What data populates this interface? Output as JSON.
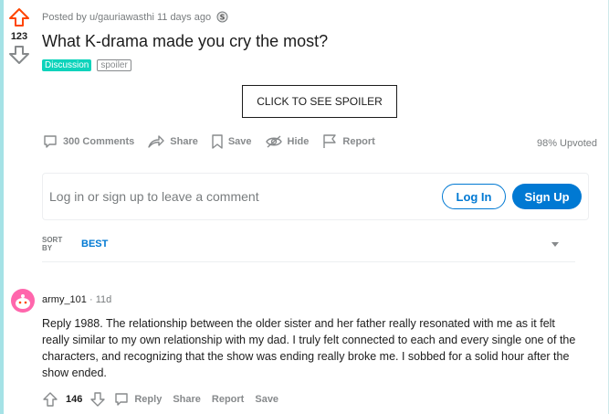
{
  "post": {
    "score": "123",
    "meta": "Posted by u/gauriawasthi 11 days ago",
    "title": "What K-drama made you cry the most?",
    "flairs": [
      "Discussion",
      "spoiler"
    ],
    "spoiler_button": "CLICK TO SEE SPOILER",
    "actions": {
      "comments": "300 Comments",
      "share": "Share",
      "save": "Save",
      "hide": "Hide",
      "report": "Report"
    },
    "upvoted": "98% Upvoted"
  },
  "comment_box": {
    "prompt": "Log in or sign up to leave a comment",
    "login": "Log In",
    "signup": "Sign Up"
  },
  "sort": {
    "label": "SORT BY",
    "value": "BEST"
  },
  "comment": {
    "author": "army_101",
    "time": "11d",
    "body": "Reply 1988. The relationship between the older sister and her father really resonated with me as it felt really similar to my own relationship with my dad. I truly felt connected to each and every single one of the characters, and recognizing that the show was ending really broke me. I sobbed for a solid hour after the show ended.",
    "score": "146",
    "actions": {
      "reply": "Reply",
      "share": "Share",
      "report": "Report",
      "save": "Save"
    }
  },
  "colors": {
    "accent": "#0079d3",
    "upvote": "#ff4500",
    "flair": "#0dd3bb",
    "avatar": "#ff66ac",
    "frame": "#a5e2e6"
  },
  "icons": [
    "upvote-arrow-icon",
    "downvote-arrow-icon",
    "award-icon",
    "comment-icon",
    "share-icon",
    "bookmark-icon",
    "hide-eye-icon",
    "report-flag-icon",
    "chevron-down-icon"
  ]
}
